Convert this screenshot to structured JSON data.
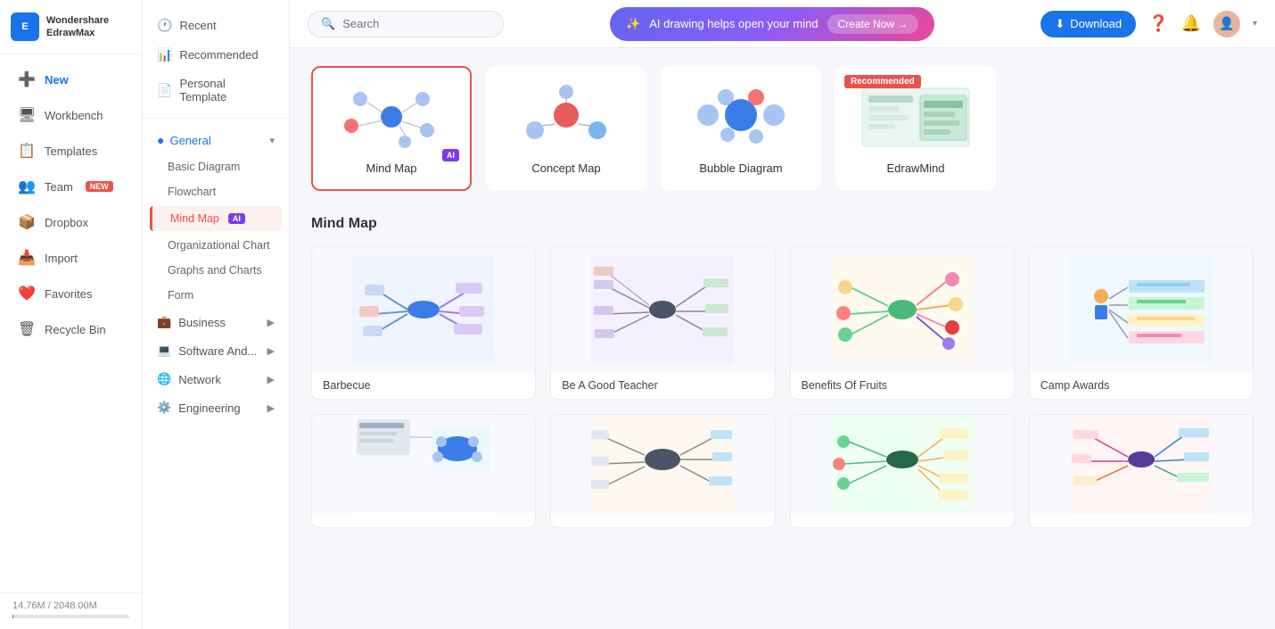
{
  "app": {
    "name": "Wondershare",
    "name2": "EdrawMax"
  },
  "sidebar": {
    "items": [
      {
        "id": "new",
        "label": "New",
        "icon": "➕",
        "badge": null,
        "active": false
      },
      {
        "id": "workbench",
        "label": "Workbench",
        "icon": "🖥",
        "badge": null
      },
      {
        "id": "templates",
        "label": "Templates",
        "icon": "📋",
        "badge": null
      },
      {
        "id": "team",
        "label": "Team",
        "icon": "👥",
        "badge": "NEW"
      },
      {
        "id": "dropbox",
        "label": "Dropbox",
        "icon": "📦",
        "badge": null
      },
      {
        "id": "import",
        "label": "Import",
        "icon": "📥",
        "badge": null
      },
      {
        "id": "favorites",
        "label": "Favorites",
        "icon": "❤️",
        "badge": null
      },
      {
        "id": "recycle-bin",
        "label": "Recycle Bin",
        "icon": "🗑",
        "badge": null
      }
    ],
    "storage": {
      "used": "14.76M",
      "total": "2048.00M"
    }
  },
  "second_sidebar": {
    "items_top": [
      {
        "id": "recent",
        "label": "Recent",
        "icon": "🕐"
      },
      {
        "id": "recommended",
        "label": "Recommended",
        "icon": "📊"
      },
      {
        "id": "personal-template",
        "label": "Personal Template",
        "icon": "📄"
      }
    ],
    "categories": [
      {
        "id": "general",
        "label": "General",
        "expanded": true,
        "color": "#1a73e8",
        "subs": [
          {
            "id": "basic-diagram",
            "label": "Basic Diagram",
            "active": false
          },
          {
            "id": "flowchart",
            "label": "Flowchart",
            "active": false
          },
          {
            "id": "mind-map",
            "label": "Mind Map",
            "active": true,
            "ai": true
          },
          {
            "id": "org-chart",
            "label": "Organizational Chart",
            "active": false
          },
          {
            "id": "graphs",
            "label": "Graphs and Charts",
            "active": false
          },
          {
            "id": "form",
            "label": "Form",
            "active": false
          }
        ]
      },
      {
        "id": "business",
        "label": "Business",
        "expanded": false
      },
      {
        "id": "software",
        "label": "Software And...",
        "expanded": false
      },
      {
        "id": "network",
        "label": "Network",
        "expanded": false
      },
      {
        "id": "engineering",
        "label": "Engineering",
        "expanded": false
      }
    ]
  },
  "topbar": {
    "search_placeholder": "Search",
    "ai_banner_text": "AI drawing helps open your mind",
    "ai_banner_btn": "Create Now →",
    "download_btn": "Download"
  },
  "type_cards": [
    {
      "id": "mind-map",
      "label": "Mind Map",
      "active": true,
      "recommended": false,
      "ai": true
    },
    {
      "id": "concept-map",
      "label": "Concept Map",
      "active": false,
      "recommended": false,
      "ai": false
    },
    {
      "id": "bubble-diagram",
      "label": "Bubble Diagram",
      "active": false,
      "recommended": false,
      "ai": false
    },
    {
      "id": "edrawmind",
      "label": "EdrawMind",
      "active": false,
      "recommended": true,
      "ai": false
    }
  ],
  "section": {
    "title": "Mind Map"
  },
  "templates": [
    {
      "id": "barbecue",
      "name": "Barbecue"
    },
    {
      "id": "good-teacher",
      "name": "Be A Good Teacher"
    },
    {
      "id": "benefits-fruits",
      "name": "Benefits Of Fruits"
    },
    {
      "id": "camp-awards",
      "name": "Camp Awards"
    },
    {
      "id": "template5",
      "name": ""
    },
    {
      "id": "template6",
      "name": ""
    },
    {
      "id": "template7",
      "name": ""
    },
    {
      "id": "template8",
      "name": ""
    }
  ]
}
